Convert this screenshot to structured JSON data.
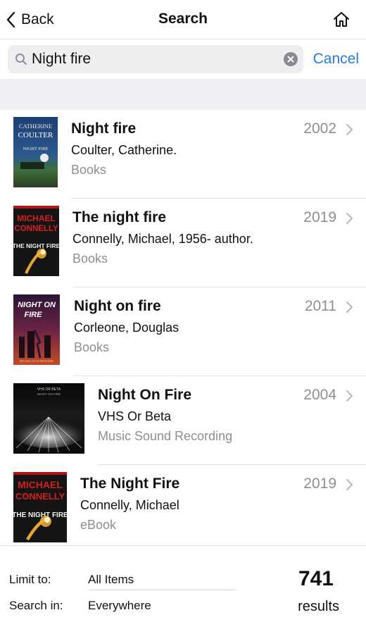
{
  "nav": {
    "back_label": "Back",
    "title": "Search"
  },
  "search": {
    "query": "Night fire",
    "cancel_label": "Cancel"
  },
  "results": [
    {
      "title": "Night fire",
      "author": "Coulter, Catherine.",
      "format": "Books",
      "year": "2002",
      "cover_line1": "CATHERINE",
      "cover_line2": "COULTER",
      "cover_line3": "NIGHT FIRE"
    },
    {
      "title": "The night fire",
      "author": "Connelly, Michael, 1956- author.",
      "format": "Books",
      "year": "2019",
      "cover_line1": "MICHAEL",
      "cover_line2": "CONNELLY",
      "cover_line3": "THE NIGHT FIRE"
    },
    {
      "title": "Night on fire",
      "author": "Corleone, Douglas",
      "format": "Books",
      "year": "2011",
      "cover_line1": "NIGHT ON",
      "cover_line2": "FIRE",
      "cover_line3": "DOUGLAS CORLEONE"
    },
    {
      "title": "Night On Fire",
      "author": "VHS Or Beta",
      "format": "Music Sound Recording",
      "year": "2004",
      "cover_line1": "VHS OR BETA",
      "cover_line2": "NIGHT ON FIRE"
    },
    {
      "title": "The Night Fire",
      "author": "Connelly, Michael",
      "format": "eBook",
      "year": "2019",
      "cover_line1": "MICHAEL",
      "cover_line2": "CONNELLY",
      "cover_line3": "THE NIGHT FIRE"
    }
  ],
  "footer": {
    "limit_label": "Limit to:",
    "limit_value": "All Items",
    "search_in_label": "Search in:",
    "search_in_value": "Everywhere",
    "result_count": "741",
    "result_count_label": "results"
  },
  "colors": {
    "accent": "#1f7ce8",
    "secondary_text": "#8e8e93",
    "band": "#efeff4"
  },
  "icons": [
    "chevron-left-icon",
    "home-icon",
    "search-icon",
    "clear-icon",
    "chevron-right-icon"
  ]
}
